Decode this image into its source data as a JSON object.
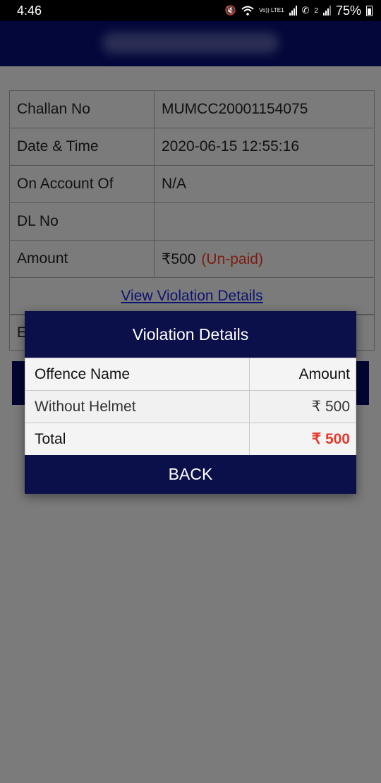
{
  "status_bar": {
    "time": "4:46",
    "volte": "Vo)) LTE1",
    "sim2": "2",
    "battery": "75%"
  },
  "challan": {
    "rows": [
      {
        "label": "Challan No",
        "value": "MUMCC20001154075"
      },
      {
        "label": "Date & Time",
        "value": "2020-06-15 12:55:16"
      },
      {
        "label": "On Account Of",
        "value": "N/A"
      },
      {
        "label": "DL No",
        "value": ""
      },
      {
        "label": "Amount",
        "value": "₹500",
        "status": "(Un-paid)"
      }
    ],
    "view_link": "View Violation Details",
    "partial_label": "E"
  },
  "dialog": {
    "title": "Violation Details",
    "header": {
      "name": "Offence Name",
      "amount": "Amount"
    },
    "offences": [
      {
        "name": "Without Helmet",
        "amount": "₹ 500"
      }
    ],
    "total": {
      "label": "Total",
      "amount": "₹ 500"
    },
    "back_label": "BACK"
  },
  "colors": {
    "header_navy": "#0b0f4a",
    "total_red": "#e53a2e",
    "unpaid_red": "#7b1c10",
    "link_blue": "#0d1370"
  }
}
